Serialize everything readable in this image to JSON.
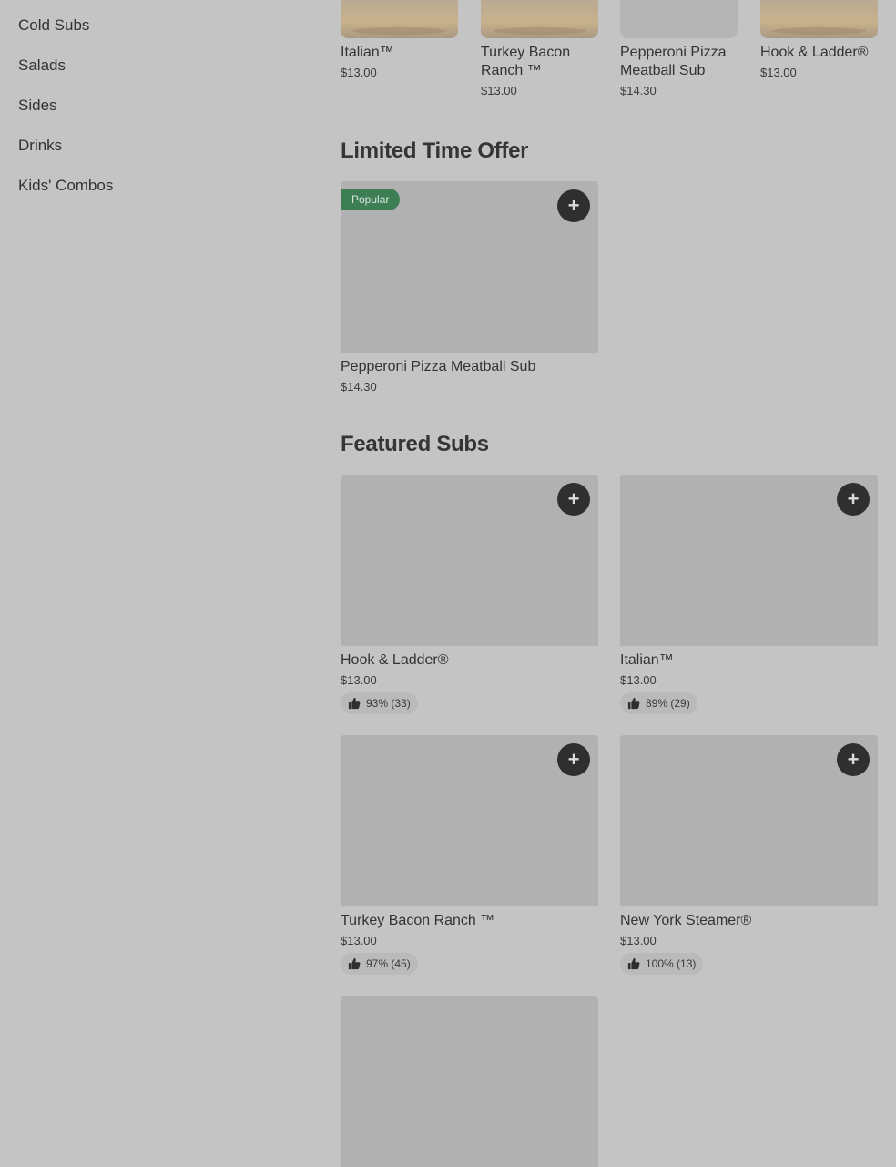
{
  "sidebar": {
    "items": [
      {
        "label": "Cold Subs"
      },
      {
        "label": "Salads"
      },
      {
        "label": "Sides"
      },
      {
        "label": "Drinks"
      },
      {
        "label": "Kids' Combos"
      }
    ]
  },
  "carousel": {
    "items": [
      {
        "name": "Italian™",
        "price": "$13.00"
      },
      {
        "name": "Turkey Bacon Ranch ™",
        "price": "$13.00"
      },
      {
        "name": "Pepperoni Pizza Meatball Sub",
        "price": "$14.30"
      },
      {
        "name": "Hook & Ladder®",
        "price": "$13.00"
      }
    ]
  },
  "limited": {
    "title": "Limited Time Offer",
    "card": {
      "badge": "Popular",
      "name": "Pepperoni Pizza Meatball Sub",
      "price": "$14.30",
      "add_icon": "plus-icon"
    }
  },
  "featured": {
    "title": "Featured Subs",
    "cards": [
      {
        "name": "Hook & Ladder®",
        "price": "$13.00",
        "rating": "93% (33)"
      },
      {
        "name": "Italian™",
        "price": "$13.00",
        "rating": "89% (29)"
      },
      {
        "name": "Turkey Bacon Ranch ™",
        "price": "$13.00",
        "rating": "97% (45)"
      },
      {
        "name": "New York Steamer®",
        "price": "$13.00",
        "rating": "100% (13)"
      }
    ]
  },
  "icons": {
    "add": "+",
    "rating": "thumbs-up-icon"
  },
  "colors": {
    "badge": "#3d7e55",
    "add_button": "#2f2f2f",
    "background": "#c4c4c4"
  }
}
